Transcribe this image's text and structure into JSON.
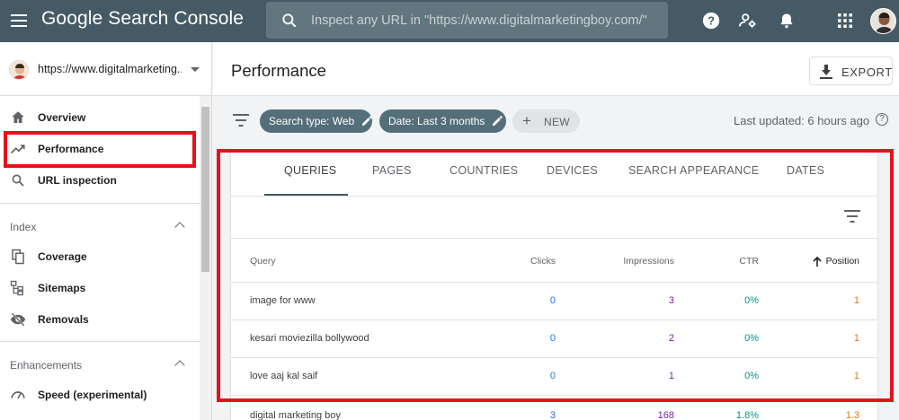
{
  "app": {
    "brand": "Google Search Console"
  },
  "search": {
    "placeholder": "Inspect any URL in \"https://www.digitalmarketingboy.com/\""
  },
  "property": {
    "label": "https://www.digitalmarketing..."
  },
  "sidebar": {
    "items": [
      {
        "label": "Overview",
        "icon": "home-icon"
      },
      {
        "label": "Performance",
        "icon": "trending-up-icon"
      },
      {
        "label": "URL inspection",
        "icon": "search-icon"
      }
    ],
    "sections": [
      {
        "title": "Index",
        "items": [
          {
            "label": "Coverage",
            "icon": "file-copy-icon"
          },
          {
            "label": "Sitemaps",
            "icon": "sitemap-icon"
          },
          {
            "label": "Removals",
            "icon": "eye-off-icon"
          }
        ]
      },
      {
        "title": "Enhancements",
        "items": [
          {
            "label": "Speed (experimental)",
            "icon": "speedometer-icon"
          }
        ]
      }
    ]
  },
  "header": {
    "title": "Performance",
    "export_label": "EXPORT"
  },
  "filters": {
    "chips": [
      "Search type: Web",
      "Date: Last 3 months"
    ],
    "new_label": "NEW",
    "last_updated": "Last updated: 6 hours ago"
  },
  "tabs": [
    "QUERIES",
    "PAGES",
    "COUNTRIES",
    "DEVICES",
    "SEARCH APPEARANCE",
    "DATES"
  ],
  "table": {
    "headers": {
      "query": "Query",
      "clicks": "Clicks",
      "impressions": "Impressions",
      "ctr": "CTR",
      "position": "Position"
    },
    "rows": [
      {
        "query": "image for www",
        "clicks": "0",
        "impressions": "3",
        "ctr": "0%",
        "position": "1"
      },
      {
        "query": "kesari moviezilla bollywood",
        "clicks": "0",
        "impressions": "2",
        "ctr": "0%",
        "position": "1"
      },
      {
        "query": "love aaj kal saif",
        "clicks": "0",
        "impressions": "1",
        "ctr": "0%",
        "position": "1"
      },
      {
        "query": "digital marketing boy",
        "clicks": "3",
        "impressions": "168",
        "ctr": "1.8%",
        "position": "1.3"
      }
    ]
  },
  "colors": {
    "appbar": "#455a64",
    "clicks": "#1a73e8",
    "impressions": "#7b1fa2",
    "ctr": "#009688",
    "position": "#e8710a",
    "highlight": "#e8101c"
  }
}
